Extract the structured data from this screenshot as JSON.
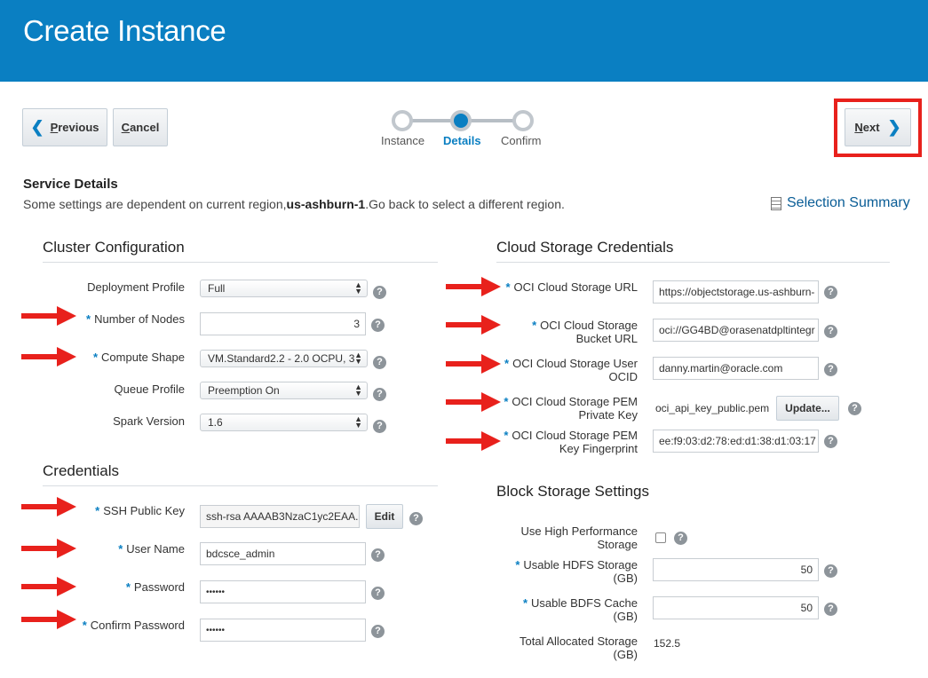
{
  "header": {
    "title": "Create Instance"
  },
  "nav": {
    "previous_rest": "revious",
    "previous_key": "P",
    "cancel_key": "C",
    "cancel_rest": "ancel",
    "next_key": "N",
    "next_rest": "ext"
  },
  "train": {
    "steps": [
      "Instance",
      "Details",
      "Confirm"
    ],
    "active": "Details"
  },
  "service": {
    "title": "Service Details",
    "note_prefix": "Some settings are dependent on current region,",
    "note_region": "us-ashburn-1",
    "note_suffix": ".Go back to select a different region.",
    "summary_label": "Selection Summary"
  },
  "cluster": {
    "title": "Cluster Configuration",
    "deployment_profile_label": "Deployment Profile",
    "deployment_profile_value": "Full",
    "nodes_label": "Number of Nodes",
    "nodes_value": "3",
    "shape_label": "Compute Shape",
    "shape_value": "VM.Standard2.2 - 2.0 OCPU, 3",
    "queue_label": "Queue Profile",
    "queue_value": "Preemption On",
    "spark_label": "Spark Version",
    "spark_value": "1.6"
  },
  "credentials": {
    "title": "Credentials",
    "ssh_label": "SSH Public Key",
    "ssh_value": "ssh-rsa AAAAB3NzaC1yc2EAA.",
    "edit_label": "Edit",
    "user_label": "User Name",
    "user_value": "bdcsce_admin",
    "password_label": "Password",
    "password_value": "••••••",
    "confirm_label": "Confirm Password",
    "confirm_value": "••••••"
  },
  "cloud": {
    "title": "Cloud Storage Credentials",
    "url_label": "OCI Cloud Storage URL",
    "url_value": "https://objectstorage.us-ashburn-",
    "bucket_label_1": "OCI Cloud Storage",
    "bucket_label_2": "Bucket URL",
    "bucket_value": "oci://GG4BD@orasenatdpltintegr",
    "ocid_label_1": "OCI Cloud Storage User",
    "ocid_label_2": "OCID",
    "ocid_value": "danny.martin@oracle.com",
    "pem_label_1": "OCI Cloud Storage PEM",
    "pem_label_2": "Private Key",
    "pem_value": "oci_api_key_public.pem",
    "update_label": "Update...",
    "fp_label_1": "OCI Cloud Storage PEM",
    "fp_label_2": "Key Fingerprint",
    "fp_value": "ee:f9:03:d2:78:ed:d1:38:d1:03:17"
  },
  "block": {
    "title": "Block Storage Settings",
    "hp_label_1": "Use High Performance",
    "hp_label_2": "Storage",
    "hdfs_label_1": "Usable HDFS Storage",
    "hdfs_label_2": "(GB)",
    "hdfs_value": "50",
    "bdfs_label_1": "Usable BDFS Cache",
    "bdfs_label_2": "(GB)",
    "bdfs_value": "50",
    "total_label_1": "Total Allocated Storage",
    "total_label_2": "(GB)",
    "total_value": "152.5"
  },
  "colors": {
    "brand": "#0a7fc2",
    "annotation": "#e8211c"
  },
  "icons": [
    "chevron-left-icon",
    "chevron-right-icon",
    "selection-summary-icon",
    "help-icon",
    "red-arrow-annotation"
  ]
}
